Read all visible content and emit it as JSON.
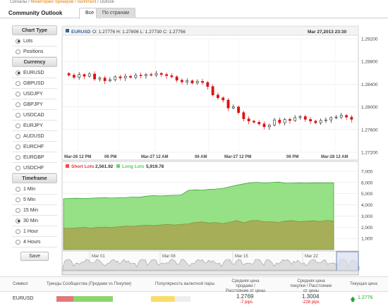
{
  "breadcrumb": {
    "prefix": "Сигналы /",
    "link1": "Мониторинг брокеров",
    "sep": "/",
    "link2": "Sentiment",
    "tail": "/ Outlook"
  },
  "header": {
    "title": "Community Outlook",
    "tabs": [
      {
        "label": "Все",
        "active": true
      },
      {
        "label": "По странам",
        "active": false
      }
    ]
  },
  "sidebar": {
    "chart_type": {
      "title": "Chart Type",
      "options": [
        {
          "label": "Lots",
          "selected": true
        },
        {
          "label": "Positions",
          "selected": false
        }
      ]
    },
    "currency": {
      "title": "Currency",
      "options": [
        {
          "label": "EURUSD",
          "selected": true
        },
        {
          "label": "GBPUSD",
          "selected": false
        },
        {
          "label": "USDJPY",
          "selected": false
        },
        {
          "label": "GBPJPY",
          "selected": false
        },
        {
          "label": "USDCAD",
          "selected": false
        },
        {
          "label": "EURJPY",
          "selected": false
        },
        {
          "label": "AUDUSD",
          "selected": false
        },
        {
          "label": "EURCHF",
          "selected": false
        },
        {
          "label": "EURGBP",
          "selected": false
        },
        {
          "label": "USDCHF",
          "selected": false
        }
      ]
    },
    "timeframe": {
      "title": "Timeframe",
      "options": [
        {
          "label": "1 Min",
          "selected": false
        },
        {
          "label": "5 Min",
          "selected": false
        },
        {
          "label": "15 Min",
          "selected": false
        },
        {
          "label": "30 Min",
          "selected": true
        },
        {
          "label": "1 Hour",
          "selected": false
        },
        {
          "label": "4 Hours",
          "selected": false
        }
      ]
    },
    "save_label": "Save"
  },
  "price_chart": {
    "symbol": "EURUSD",
    "ohlc_text": "O: 1.27776 H: 1.27806 L: 1.27730 C: 1.27756",
    "timestamp": "Mar 27,2013 23:30"
  },
  "lots_legend": {
    "short_label": "Short Lots",
    "short_value": "2,561.92",
    "long_label": "Long Lots",
    "long_value": "5,919.78"
  },
  "navigator_labels": [
    "Mar 01",
    "Mar 08",
    "Mar 15",
    "Mar 22"
  ],
  "colors": {
    "short": "#f44",
    "long": "#69d769",
    "long_fill": "#96e086",
    "short_fill": "#a6ae58",
    "up": "#222",
    "down": "#d11",
    "accent": "#336699"
  },
  "chart_data": [
    {
      "type": "candlestick",
      "ylim": [
        1.272,
        1.292
      ],
      "y_ticks": [
        "1.29200",
        "1.28800",
        "1.28400",
        "1.28000",
        "1.27600",
        "1.27200"
      ],
      "x_ticks": [
        "Mar-26 12 PM",
        "06 PM",
        "Mar-27 12 AM",
        "06 AM",
        "Mar-27 12 PM",
        "06 PM",
        "Mar-28 12 AM"
      ],
      "series": [
        {
          "close": [
            1.2856,
            1.2852,
            1.2857,
            1.2854,
            1.2858,
            1.2849,
            1.2851,
            1.2846,
            1.2848,
            1.2853,
            1.2851,
            1.2854,
            1.2852,
            1.2856,
            1.2855,
            1.2857,
            1.2856,
            1.2859,
            1.2857,
            1.2855,
            1.2853,
            1.2847,
            1.2844,
            1.2846,
            1.2842,
            1.2845,
            1.2843,
            1.2836,
            1.2821,
            1.2816,
            1.2812,
            1.2798,
            1.28,
            1.279,
            1.2779,
            1.2775,
            1.2773,
            1.277,
            1.2765,
            1.2768,
            1.2777,
            1.2772,
            1.2778,
            1.2776,
            1.2781,
            1.2783,
            1.2778,
            1.2775,
            1.2772,
            1.2776,
            1.2777,
            1.2781,
            1.2782,
            1.2785,
            1.2782,
            1.2778
          ]
        }
      ]
    },
    {
      "type": "area",
      "ylim": [
        0,
        7000
      ],
      "y_ticks": [
        "7,000",
        "6,000",
        "5,000",
        "4,000",
        "3,000",
        "2,000",
        "1,000"
      ],
      "series": [
        {
          "name": "Long Lots",
          "values": [
            4550,
            4580,
            4590,
            4560,
            4600,
            4620,
            4640,
            4610,
            4640,
            4660,
            4700,
            4680,
            4780,
            4830,
            4800,
            4840,
            4860,
            4880,
            5300,
            5350,
            5320,
            5380,
            5420,
            5480,
            5620,
            5760,
            5880,
            5980,
            6020,
            5960,
            6000,
            6040,
            5960,
            5950,
            5980,
            5960,
            5980,
            5970,
            5980,
            5970
          ]
        },
        {
          "name": "Short Lots",
          "values": [
            1920,
            1900,
            1950,
            1980,
            1920,
            2000,
            2020,
            1980,
            2050,
            2100,
            2080,
            2150,
            2180,
            2150,
            2200,
            2250,
            2200,
            2260,
            2300,
            2420,
            2480,
            2380,
            2430,
            2320,
            2460,
            2600,
            2400,
            2580,
            2620,
            2480,
            2500,
            2420,
            2560,
            2600,
            2500,
            2540,
            2590,
            2510,
            2620,
            2560
          ]
        }
      ]
    }
  ],
  "table": {
    "headers": [
      "Символ",
      "Тренды Сообщества (Продажи vs Покупки)",
      "Популярность валютной пары",
      "Средняя цена продажи / Расстояние от цены",
      "Средняя цена покупки / Расстояние от цены",
      "Текущая цена"
    ],
    "rows": [
      {
        "symbol": "EURUSD",
        "sell_pct": 0.3,
        "popularity_pct": 0.6,
        "avg_sell": "1.2769",
        "avg_sell_pips": "-7 pips",
        "avg_buy": "1.3004",
        "avg_buy_pips": "-228 pips",
        "current": "1.2776"
      }
    ]
  }
}
